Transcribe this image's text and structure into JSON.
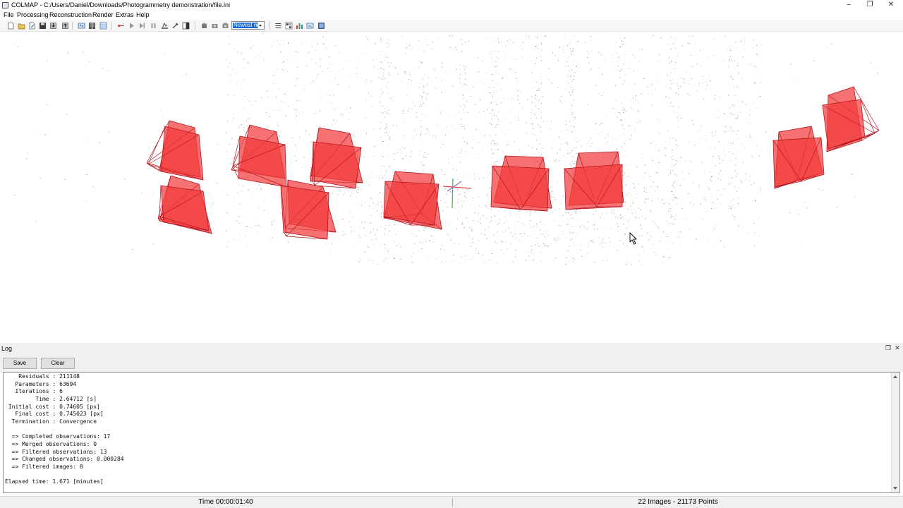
{
  "window": {
    "title": "COLMAP - C:/Users/Daniel/Downloads/Photogrammetry demonstration/file.ini",
    "controls": {
      "minimize": "–",
      "maximize": "❐",
      "close": "✕"
    }
  },
  "menu": {
    "items": [
      "File",
      "Processing",
      "Reconstruction",
      "Render",
      "Extras",
      "Help"
    ]
  },
  "toolbar": {
    "render_select_value": "Newest m",
    "icons": [
      "new-project-icon",
      "open-project-icon",
      "edit-project-icon",
      "save-project-icon",
      "import-model-icon",
      "export-model-icon",
      "feature-extraction-icon",
      "feature-matching-icon",
      "database-icon",
      "reconstruction-options-icon",
      "start-reconstruction-icon",
      "step-reconstruction-icon",
      "pause-reconstruction-icon",
      "bundle-adjustment-icon",
      "dense-reconstruction-icon",
      "render-options-icon",
      "reset-view-icon",
      "grab-image-icon",
      "grab-movie-icon",
      "show-log-icon",
      "match-matrix-icon",
      "statistics-icon",
      "dataset-icon",
      "database-manager-icon"
    ]
  },
  "colors": {
    "camera_face": "#f23a3a",
    "camera_edge": "#b4141e",
    "axis_x": "#e04848",
    "axis_y": "#47b447",
    "axis_z": "#8a6ad8",
    "point": "#4a4a4a",
    "selection": "#0a64d8"
  },
  "log": {
    "title": "Log",
    "save_label": "Save",
    "clear_label": "Clear",
    "lines": [
      "    Residuals : 211148",
      "   Parameters : 63694",
      "   Iterations : 6",
      "         Time : 2.64712 [s]",
      " Initial cost : 0.74605 [px]",
      "   Final cost : 0.745023 [px]",
      "  Termination : Convergence",
      "",
      "  => Completed observations: 17",
      "  => Merged observations: 0",
      "  => Filtered observations: 13",
      "  => Changed observations: 0.000284",
      "  => Filtered images: 0",
      "",
      "Elapsed time: 1.671 [minutes]"
    ]
  },
  "status": {
    "time": "Time 00:00:01:40",
    "summary": "22 Images - 21173 Points"
  }
}
